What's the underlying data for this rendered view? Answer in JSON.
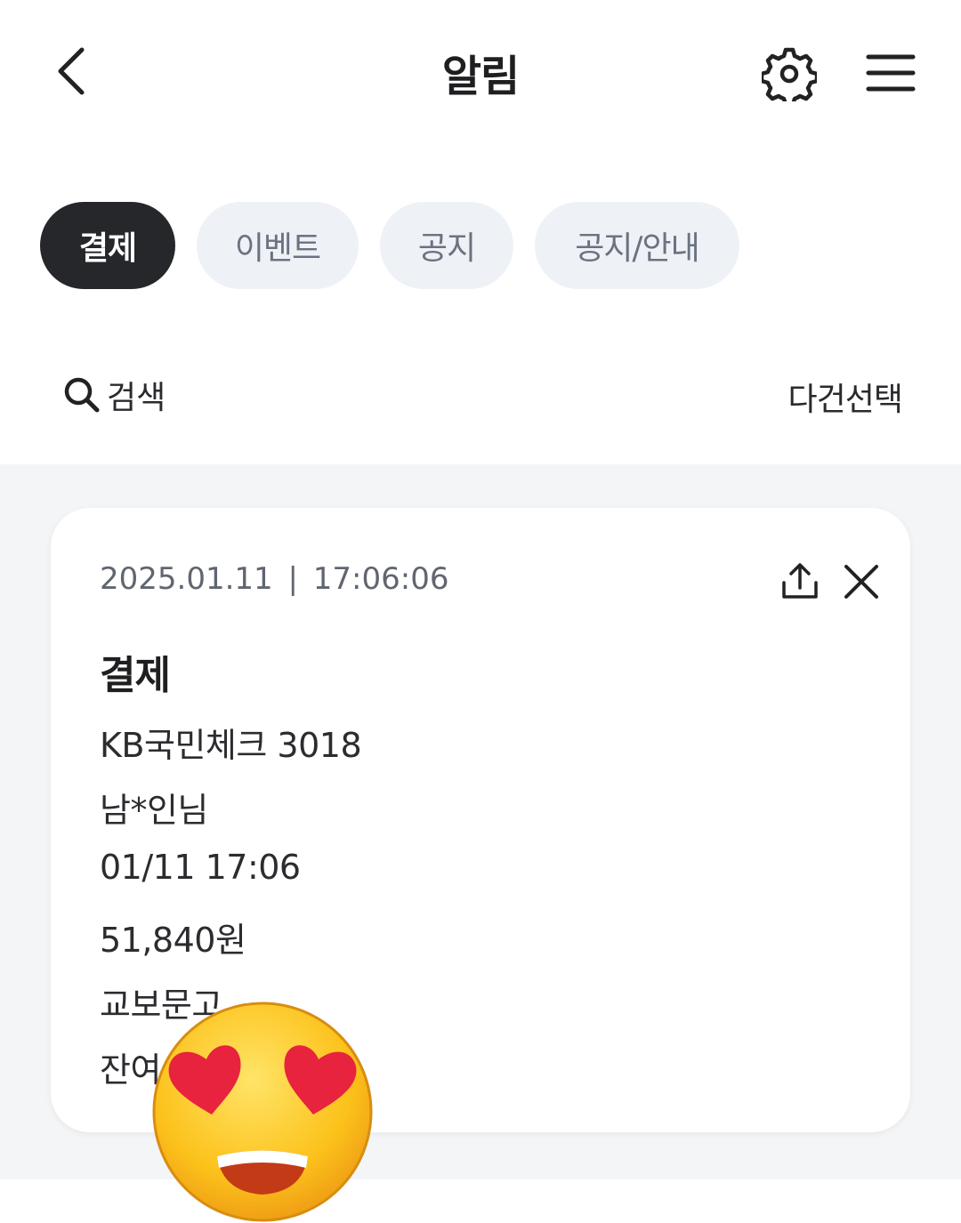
{
  "header": {
    "title": "알림",
    "back_icon": "chevron-left-icon",
    "settings_icon": "gear-icon",
    "menu_icon": "hamburger-menu-icon"
  },
  "tabs": [
    {
      "label": "결제",
      "active": true
    },
    {
      "label": "이벤트",
      "active": false
    },
    {
      "label": "공지",
      "active": false
    },
    {
      "label": "공지/안내",
      "active": false
    }
  ],
  "toolbar": {
    "search_label": "검색",
    "multi_select_label": "다건선택"
  },
  "notification": {
    "date": "2025.01.11",
    "time": "17:06:06",
    "separator": "|",
    "title": "결제",
    "lines": [
      "KB국민체크 3018",
      "남*인님",
      "01/11 17:06",
      "51,840원",
      "교보문고",
      "잔여"
    ]
  },
  "colors": {
    "active_tab_bg": "#26272b",
    "inactive_tab_bg": "#eef1f6",
    "list_bg": "#f4f5f7"
  },
  "overlay": {
    "icon": "smiling-face-with-heart-eyes-emoji"
  }
}
